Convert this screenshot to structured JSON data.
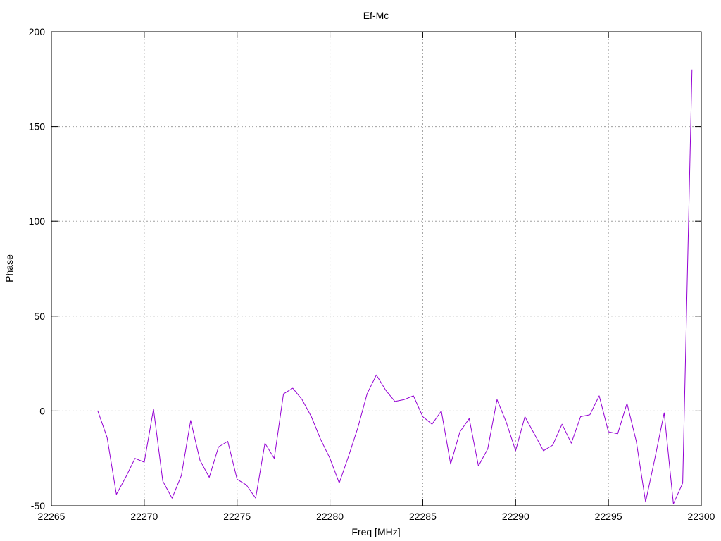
{
  "chart_data": {
    "type": "line",
    "title": "Ef-Mc",
    "xlabel": "Freq [MHz]",
    "ylabel": "Phase",
    "xlim": [
      22265,
      22300
    ],
    "ylim": [
      -50,
      200
    ],
    "x_ticks": [
      22265,
      22270,
      22275,
      22280,
      22285,
      22290,
      22295,
      22300
    ],
    "y_ticks": [
      -50,
      0,
      50,
      100,
      150,
      200
    ],
    "grid": true,
    "series": [
      {
        "color": "#9400d3",
        "x": [
          22267.5,
          22268,
          22268.5,
          22269,
          22269.5,
          22270,
          22270.5,
          22271,
          22271.5,
          22272,
          22272.5,
          22273,
          22273.5,
          22274,
          22274.5,
          22275,
          22275.5,
          22276,
          22276.5,
          22277,
          22277.5,
          22278,
          22278.5,
          22279,
          22279.5,
          22280,
          22280.5,
          22281,
          22281.5,
          22282,
          22282.5,
          22283,
          22283.5,
          22284,
          22284.5,
          22285,
          22285.5,
          22286,
          22286.5,
          22287,
          22287.5,
          22288,
          22288.5,
          22289,
          22289.5,
          22290,
          22290.5,
          22291,
          22291.5,
          22292,
          22292.5,
          22293,
          22293.5,
          22294,
          22294.5,
          22295,
          22295.5,
          22296,
          22296.5,
          22297,
          22297.5,
          22298,
          22298.5,
          22299,
          22299.5
        ],
        "y": [
          0,
          -14,
          -44,
          -35,
          -25,
          -27,
          1,
          -37,
          -46,
          -34,
          -5,
          -26,
          -35,
          -19,
          -16,
          -36,
          -39,
          -46,
          -17,
          -25,
          9,
          12,
          6,
          -3,
          -15,
          -25,
          -38,
          -24,
          -9,
          9,
          19,
          11,
          5,
          6,
          8,
          -3,
          -7,
          0,
          -28,
          -11,
          -4,
          -29,
          -20,
          6,
          -6,
          -21,
          -3,
          -12,
          -21,
          -18,
          -7,
          -17,
          -3,
          -2,
          8,
          -11,
          -12,
          4,
          -16,
          -48,
          -25,
          -1,
          -49,
          -38,
          180
        ]
      }
    ]
  }
}
